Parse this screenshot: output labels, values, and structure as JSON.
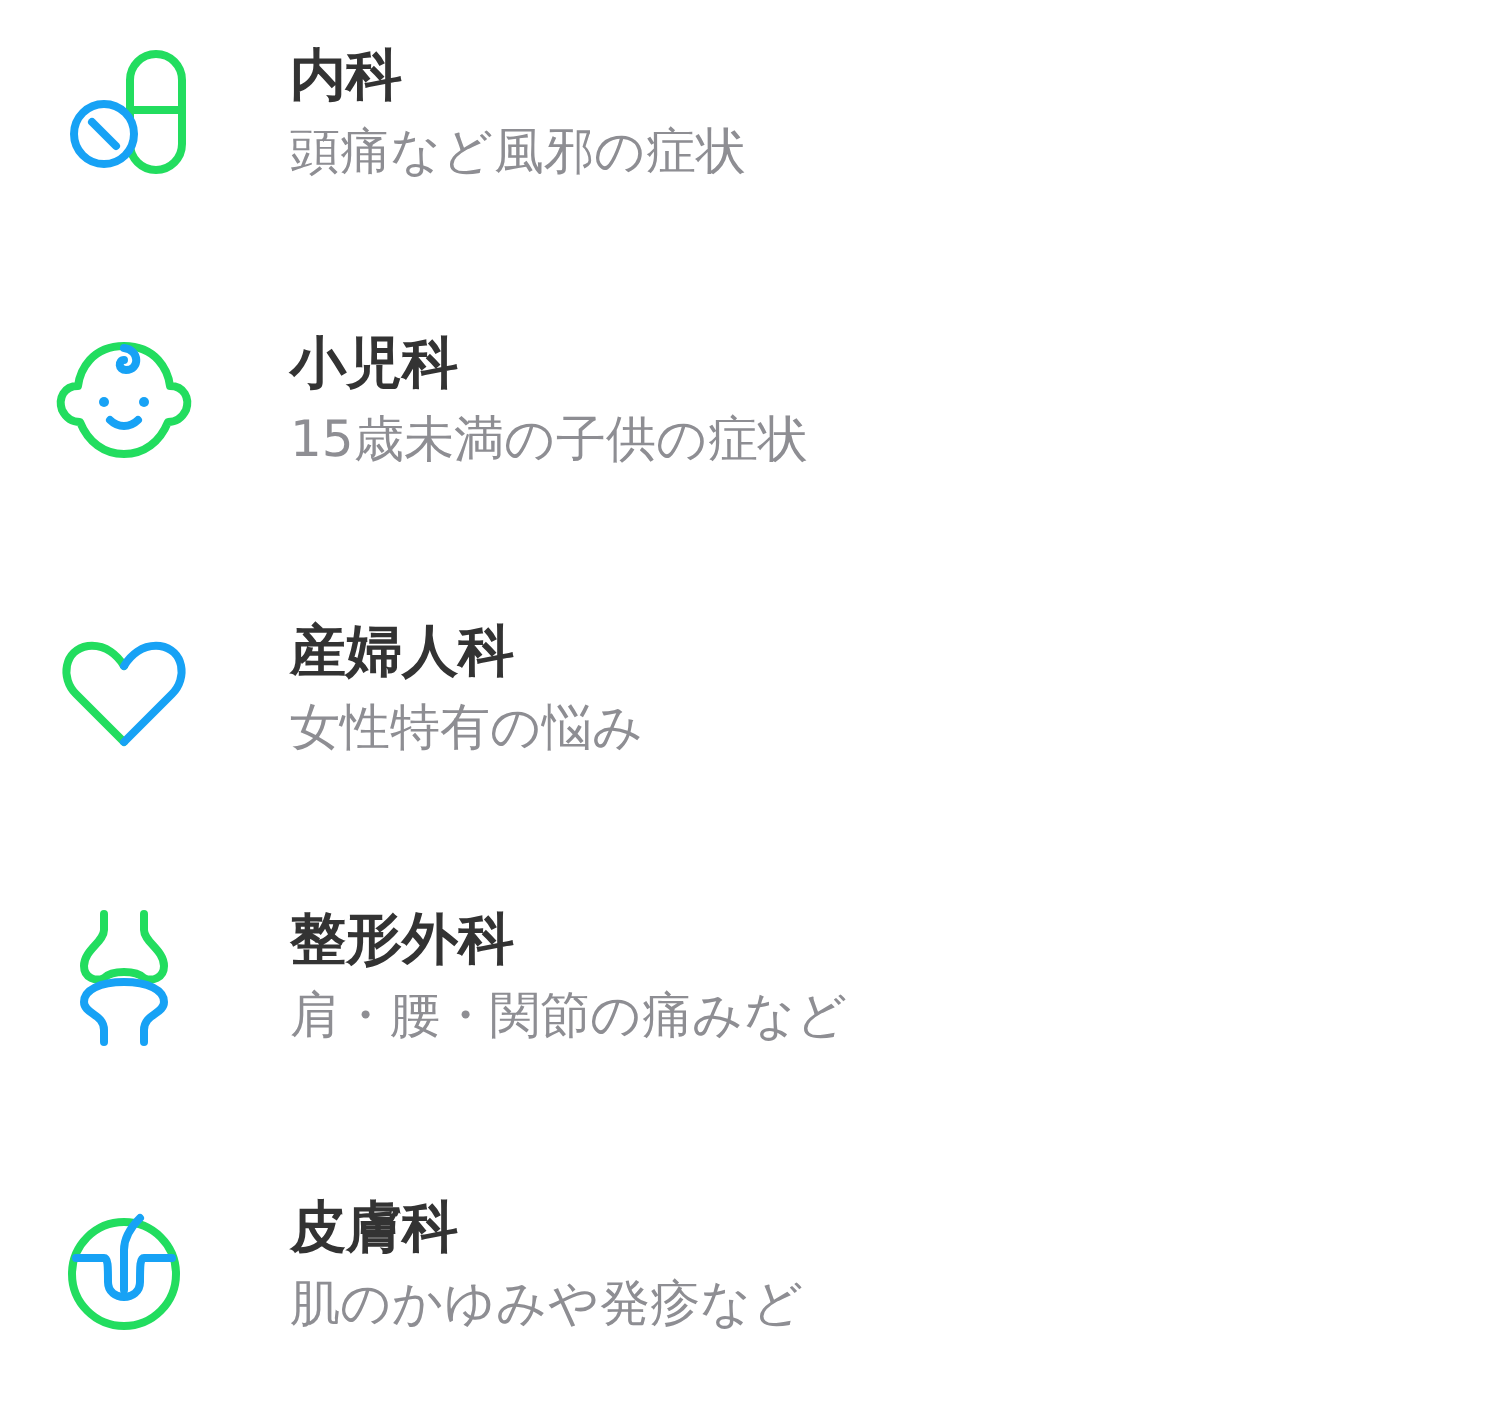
{
  "departments": [
    {
      "kind": "pill",
      "title": "内科",
      "subtitle": "頭痛など風邪の症状"
    },
    {
      "kind": "baby",
      "title": "小児科",
      "subtitle": "15歳未満の子供の症状"
    },
    {
      "kind": "heart",
      "title": "産婦人科",
      "subtitle": "女性特有の悩み"
    },
    {
      "kind": "joint",
      "title": "整形外科",
      "subtitle": "肩・腰・関節の痛みなど"
    },
    {
      "kind": "hair",
      "title": "皮膚科",
      "subtitle": "肌のかゆみや発疹など"
    }
  ]
}
